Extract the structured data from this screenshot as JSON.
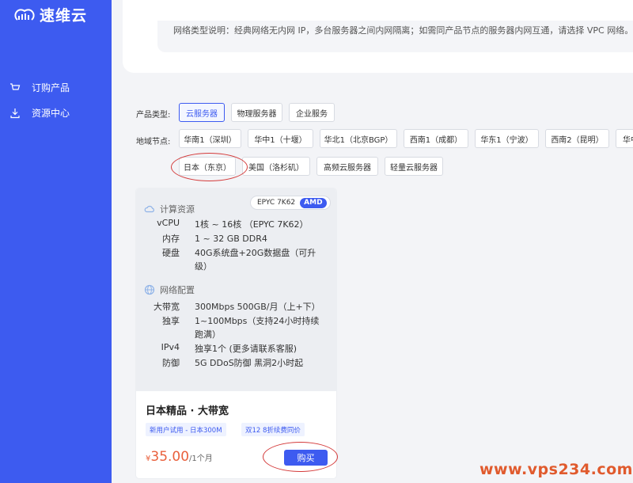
{
  "brand": {
    "name": "速维云"
  },
  "sidebar": {
    "items": [
      {
        "label": "订购产品",
        "icon": "cart-icon"
      },
      {
        "label": "资源中心",
        "icon": "download-icon"
      }
    ]
  },
  "network_note": "网络类型说明：经典网络无内网 IP，多台服务器之间内网隔离；如需同产品节点的服务器内网互通，请选择 VPC 网络。云服",
  "product_type": {
    "label": "产品类型:",
    "options": [
      "云服务器",
      "物理服务器",
      "企业服务"
    ],
    "selected": "云服务器"
  },
  "region": {
    "label": "地域节点:",
    "row1": [
      "华南1（深圳）",
      "华中1（十堰）",
      "华北1（北京BGP）",
      "西南1（成都）",
      "华东1（宁波）",
      "西南2（昆明）",
      "华中"
    ],
    "row2": [
      "日本（东京）",
      "美国（洛杉矶）",
      "高频云服务器",
      "轻量云服务器"
    ],
    "selected": "日本（东京）"
  },
  "card": {
    "cpu_model": "EPYC 7K62",
    "cpu_brand": "AMD",
    "compute_title": "计算资源",
    "compute": [
      {
        "k": "vCPU",
        "v": "1核 ~ 16核 （EPYC 7K62）"
      },
      {
        "k": "内存",
        "v": "1 ~ 32 GB DDR4"
      },
      {
        "k": "硬盘",
        "v": "40G系统盘+20G数据盘（可升级）"
      }
    ],
    "network_title": "网络配置",
    "network": [
      {
        "k": "大带宽",
        "v": "300Mbps 500GB/月（上+下）"
      },
      {
        "k": "独享",
        "v": "1~100Mbps（支持24小时持续跑满）"
      },
      {
        "k": "IPv4",
        "v": "独享1个 (更多请联系客服)"
      },
      {
        "k": "防御",
        "v": "5G DDoS防御 黑洞2小时起"
      }
    ],
    "title": "日本精品 · 大带宽",
    "promos": [
      "新用户试用 - 日本300M",
      "双12 8折续费同价"
    ],
    "price_currency": "¥",
    "price_amount": "35.00",
    "price_period": "/1个月",
    "buy_label": "购买"
  },
  "watermark": "www.vps234.com",
  "colors": {
    "brand_blue": "#3d5bf0",
    "price_orange": "#e9603c",
    "annotation_red": "#d43a3a",
    "watermark": "#e05a2d"
  }
}
